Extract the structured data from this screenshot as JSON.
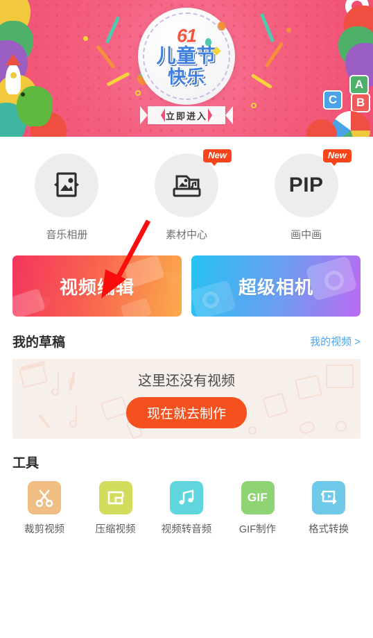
{
  "banner": {
    "name": "children-day-banner",
    "festival_number": "61",
    "festival_line1": "儿童节",
    "festival_line2": "快乐",
    "enter_label": "立即进入",
    "bg_color": "#ef4f72",
    "title_color": "#3f7fe0",
    "number_color": "#f2563f"
  },
  "quick_actions": [
    {
      "label": "音乐相册",
      "icon": "image-photo-icon",
      "badge": ""
    },
    {
      "label": "素材中心",
      "icon": "material-box-icon",
      "badge": "New"
    },
    {
      "label": "画中画",
      "icon": "pip-text-icon",
      "badge": "New",
      "icon_text": "PIP"
    }
  ],
  "main_buttons": [
    {
      "label": "视频编辑",
      "icon": "video-camera-watermark",
      "color_from": "#f4355f",
      "color_to": "#fbab4b"
    },
    {
      "label": "超级相机",
      "icon": "camera-watermark",
      "color_from": "#27c2f2",
      "color_to": "#bb6bf2"
    }
  ],
  "drafts": {
    "title": "我的草稿",
    "link_label": "我的视频 >",
    "link_color": "#4fa4f5",
    "empty_text": "这里还没有视频",
    "cta_label": "现在就去制作",
    "cta_color": "#f4511e",
    "box_color": "#f6efea"
  },
  "tools": {
    "title": "工具",
    "items": [
      {
        "label": "裁剪视频",
        "icon": "scissors-icon",
        "color": "#f0bd82"
      },
      {
        "label": "压缩视频",
        "icon": "compress-frame-icon",
        "color": "#d3dd5d"
      },
      {
        "label": "视频转音频",
        "icon": "music-notes-icon",
        "color": "#5fd6de"
      },
      {
        "label": "GIF制作",
        "icon": "gif-text-icon",
        "color": "#8fd474",
        "icon_text": "GIF"
      },
      {
        "label": "格式转换",
        "icon": "format-convert-icon",
        "color": "#6ec9e8"
      }
    ]
  },
  "annotation": {
    "arrow": "red-pointer-arrow",
    "color": "#fb0d0d"
  }
}
